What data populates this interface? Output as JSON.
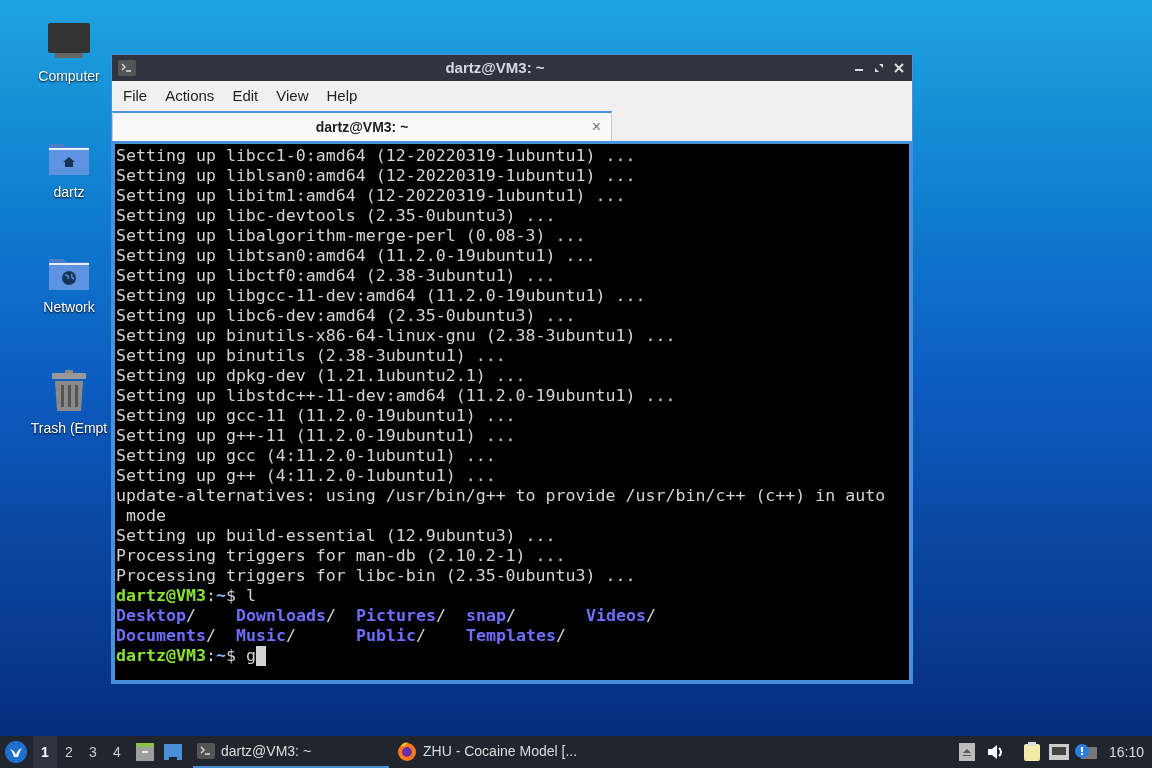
{
  "desktop_icons": [
    {
      "kind": "computer",
      "label": "Computer"
    },
    {
      "kind": "home",
      "label": "dartz"
    },
    {
      "kind": "network",
      "label": "Network"
    },
    {
      "kind": "trash",
      "label": "Trash (Empt"
    }
  ],
  "window": {
    "title": "dartz@VM3: ~",
    "menu": [
      "File",
      "Actions",
      "Edit",
      "View",
      "Help"
    ],
    "tabs": [
      {
        "label": "dartz@VM3: ~",
        "selected": true,
        "close": "×"
      }
    ],
    "terminal": [
      {
        "kind": "output",
        "text": "Setting up libcc1-0:amd64 (12-20220319-1ubuntu1) ..."
      },
      {
        "kind": "output",
        "text": "Setting up liblsan0:amd64 (12-20220319-1ubuntu1) ..."
      },
      {
        "kind": "output",
        "text": "Setting up libitm1:amd64 (12-20220319-1ubuntu1) ..."
      },
      {
        "kind": "output",
        "text": "Setting up libc-devtools (2.35-0ubuntu3) ..."
      },
      {
        "kind": "output",
        "text": "Setting up libalgorithm-merge-perl (0.08-3) ..."
      },
      {
        "kind": "output",
        "text": "Setting up libtsan0:amd64 (11.2.0-19ubuntu1) ..."
      },
      {
        "kind": "output",
        "text": "Setting up libctf0:amd64 (2.38-3ubuntu1) ..."
      },
      {
        "kind": "output",
        "text": "Setting up libgcc-11-dev:amd64 (11.2.0-19ubuntu1) ..."
      },
      {
        "kind": "output",
        "text": "Setting up libc6-dev:amd64 (2.35-0ubuntu3) ..."
      },
      {
        "kind": "output",
        "text": "Setting up binutils-x86-64-linux-gnu (2.38-3ubuntu1) ..."
      },
      {
        "kind": "output",
        "text": "Setting up binutils (2.38-3ubuntu1) ..."
      },
      {
        "kind": "output",
        "text": "Setting up dpkg-dev (1.21.1ubuntu2.1) ..."
      },
      {
        "kind": "output",
        "text": "Setting up libstdc++-11-dev:amd64 (11.2.0-19ubuntu1) ..."
      },
      {
        "kind": "output",
        "text": "Setting up gcc-11 (11.2.0-19ubuntu1) ..."
      },
      {
        "kind": "output",
        "text": "Setting up g++-11 (11.2.0-19ubuntu1) ..."
      },
      {
        "kind": "output",
        "text": "Setting up gcc (4:11.2.0-1ubuntu1) ..."
      },
      {
        "kind": "output",
        "text": "Setting up g++ (4:11.2.0-1ubuntu1) ..."
      },
      {
        "kind": "output",
        "text": "update-alternatives: using /usr/bin/g++ to provide /usr/bin/c++ (c++) in auto"
      },
      {
        "kind": "output",
        "text": " mode"
      },
      {
        "kind": "output",
        "text": "Setting up build-essential (12.9ubuntu3) ..."
      },
      {
        "kind": "output",
        "text": "Processing triggers for man-db (2.10.2-1) ..."
      },
      {
        "kind": "output",
        "text": "Processing triggers for libc-bin (2.35-0ubuntu3) ..."
      },
      {
        "kind": "prompt",
        "user": "dartz@VM3",
        "sep": ":",
        "path": "~",
        "sign": "$",
        "command": "l",
        "cursor": false
      },
      {
        "kind": "listing",
        "rows": [
          [
            {
              "name": "Desktop",
              "suffix": "/"
            },
            {
              "name": "Downloads",
              "suffix": "/"
            },
            {
              "name": "Pictures",
              "suffix": "/"
            },
            {
              "name": "snap",
              "suffix": "/"
            },
            {
              "name": "Videos",
              "suffix": "/"
            }
          ],
          [
            {
              "name": "Documents",
              "suffix": "/"
            },
            {
              "name": "Music",
              "suffix": "/"
            },
            {
              "name": "Public",
              "suffix": "/"
            },
            {
              "name": "Templates",
              "suffix": "/"
            }
          ]
        ]
      },
      {
        "kind": "prompt",
        "user": "dartz@VM3",
        "sep": ":",
        "path": "~",
        "sign": "$",
        "command": "g",
        "cursor": true
      }
    ]
  },
  "taskbar": {
    "workspaces": [
      {
        "label": "1",
        "selected": true
      },
      {
        "label": "2",
        "selected": false
      },
      {
        "label": "3",
        "selected": false
      },
      {
        "label": "4",
        "selected": false
      }
    ],
    "tasks": [
      {
        "kind": "terminal",
        "label": "dartz@VM3: ~",
        "selected": true
      },
      {
        "kind": "browser",
        "label": "ZHU - Cocaine Model [...",
        "selected": false
      }
    ],
    "clock": "16:10"
  }
}
